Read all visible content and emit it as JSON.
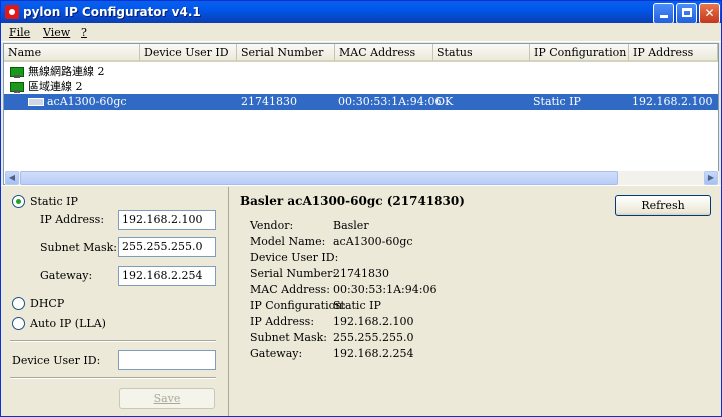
{
  "window": {
    "title": "pylon IP Configurator v4.1",
    "icon": "pylon-app-icon",
    "controls": [
      "minimize",
      "maximize",
      "close"
    ]
  },
  "menu": {
    "items": [
      {
        "label": "File",
        "accel": "F"
      },
      {
        "label": "View",
        "accel": "V"
      },
      {
        "label": "?",
        "accel": "?"
      }
    ]
  },
  "list": {
    "columns": [
      "Name",
      "Device User ID",
      "Serial Number",
      "MAC Address",
      "Status",
      "IP Configuration",
      "IP Address"
    ],
    "groups": [
      {
        "name": "無線網路連線 2"
      },
      {
        "name": "區域連線 2"
      }
    ],
    "device": {
      "name": "acA1300-60gc",
      "user_id": "",
      "serial": "21741830",
      "mac": "00:30:53:1A:94:06",
      "status": "OK",
      "ip_config": "Static IP",
      "ip": "192.168.2.100"
    }
  },
  "config": {
    "static_ip_label": "Static IP",
    "ip_address_label": "IP Address:",
    "ip_address_value": "192.168.2.100",
    "subnet_label": "Subnet Mask:",
    "subnet_value": "255.255.255.0",
    "gateway_label": "Gateway:",
    "gateway_value": "192.168.2.254",
    "dhcp_label": "DHCP",
    "auto_ip_label": "Auto IP (LLA)",
    "user_id_label": "Device User ID:",
    "user_id_value": "",
    "save_label": "Save",
    "selected_mode": "Static IP"
  },
  "details": {
    "title": "Basler acA1300-60gc (21741830)",
    "refresh_label": "Refresh",
    "rows": [
      {
        "key": "Vendor:",
        "value": "Basler"
      },
      {
        "key": "Model Name:",
        "value": "acA1300-60gc"
      },
      {
        "key": "Device User ID:",
        "value": ""
      },
      {
        "key": "Serial Number:",
        "value": "21741830"
      },
      {
        "key": "MAC Address:",
        "value": "00:30:53:1A:94:06"
      },
      {
        "key": "IP Configuration:",
        "value": "Static IP"
      },
      {
        "key": "IP Address:",
        "value": "192.168.2.100"
      },
      {
        "key": "Subnet Mask:",
        "value": "255.255.255.0"
      },
      {
        "key": "Gateway:",
        "value": "192.168.2.254"
      }
    ]
  },
  "colors": {
    "titlebar": "#0058ee",
    "selection": "#316ac5",
    "window_bg": "#ece9d8",
    "network_icon": "#1a9a1a"
  }
}
